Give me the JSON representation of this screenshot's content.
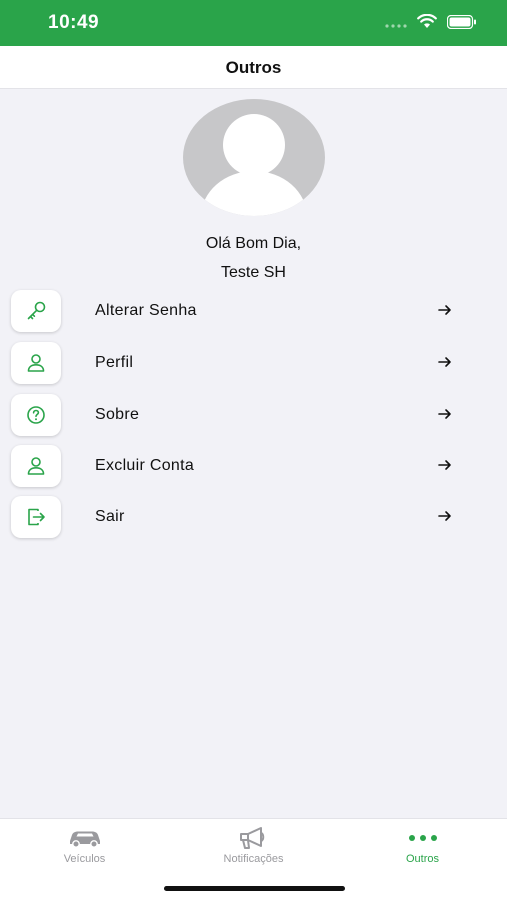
{
  "status_bar": {
    "time": "10:49",
    "signal_icon": "signal-dots-icon",
    "wifi_icon": "wifi-icon",
    "battery_icon": "battery-icon"
  },
  "header": {
    "title": "Outros"
  },
  "profile": {
    "avatar_icon": "user-placeholder-icon",
    "greeting": "Olá Bom Dia,",
    "user_name": "Teste SH"
  },
  "menu": {
    "items": [
      {
        "label": "Alterar Senha",
        "icon": "key-icon"
      },
      {
        "label": "Perfil",
        "icon": "person-icon"
      },
      {
        "label": "Sobre",
        "icon": "question-circle-icon"
      },
      {
        "label": "Excluir Conta",
        "icon": "person-icon"
      },
      {
        "label": "Sair",
        "icon": "logout-icon"
      }
    ],
    "arrow_icon": "arrow-right-icon"
  },
  "tabs": [
    {
      "label": "Veículos",
      "icon": "car-icon",
      "active": false
    },
    {
      "label": "Notificações",
      "icon": "megaphone-icon",
      "active": false
    },
    {
      "label": "Outros",
      "icon": "more-dots-icon",
      "active": true
    }
  ],
  "colors": {
    "accent": "#2aa44a",
    "background": "#f2f2f7",
    "inactive": "#9a9a9e"
  }
}
